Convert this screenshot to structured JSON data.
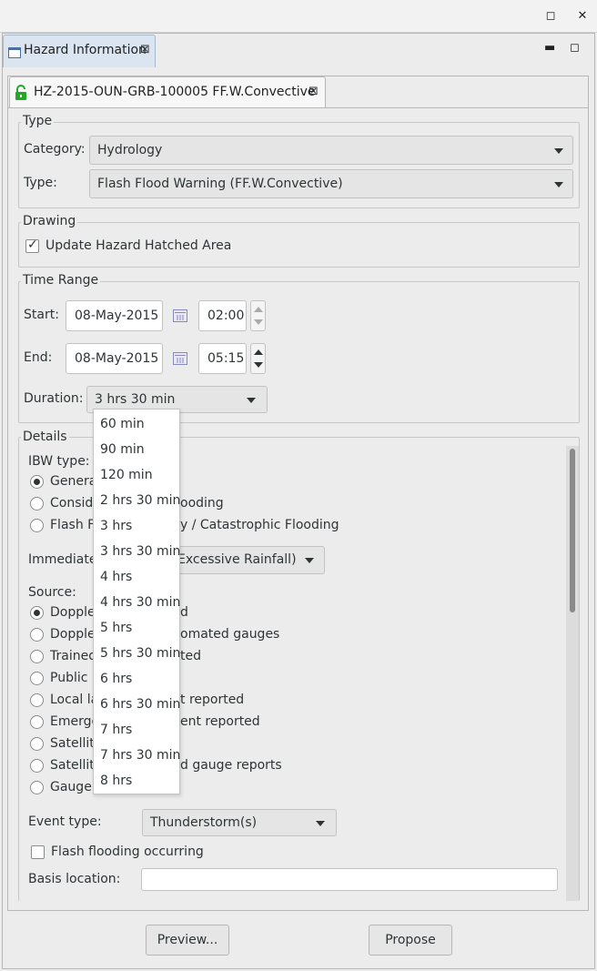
{
  "window": {
    "maximize_glyph": "◻",
    "close_glyph": "✕"
  },
  "view_tab": {
    "label": "Hazard Information",
    "close_glyph": "⊠",
    "minimize_glyph": "▬",
    "maximize_glyph": "◻"
  },
  "hazard_tab": {
    "label": "HZ-2015-OUN-GRB-100005 FF.W.Convective",
    "close_glyph": "⊠",
    "lock_color": "#23a823"
  },
  "type_group": {
    "legend": "Type",
    "category_label": "Category:",
    "category_value": "Hydrology",
    "type_label": "Type:",
    "type_value": "Flash Flood Warning (FF.W.Convective)"
  },
  "drawing_group": {
    "legend": "Drawing",
    "update_hatched_label": "Update Hazard Hatched Area",
    "update_hatched_checked": true
  },
  "time_group": {
    "legend": "Time Range",
    "start_label": "Start:",
    "start_date": "08-May-2015",
    "start_time": "02:00",
    "end_label": "End:",
    "end_date": "08-May-2015",
    "end_time": "05:15",
    "duration_label": "Duration:",
    "duration_value": "3 hrs 30 min"
  },
  "details_group": {
    "legend": "Details",
    "ibw_label": "IBW type:",
    "ibw_options": [
      {
        "visible_left": "Genera",
        "visible_right": "",
        "selected": true
      },
      {
        "visible_left": "Conside",
        "visible_right": "ooding",
        "selected": false
      },
      {
        "visible_left": "Flash F",
        "visible_right": "y / Catastrophic Flooding",
        "selected": false
      }
    ],
    "immediate_label": "Immediate",
    "immediate_value_visible": "Excessive Rainfall)",
    "source_label": "Source:",
    "sources": [
      {
        "visible_left": "Dopple",
        "visible_right": "d",
        "selected": true
      },
      {
        "visible_left": "Dopple",
        "visible_right": "omated gauges",
        "selected": false
      },
      {
        "visible_left": "Trained",
        "visible_right": "ted",
        "selected": false
      },
      {
        "visible_left": "Public r",
        "visible_right": "",
        "selected": false
      },
      {
        "visible_left": "Local la",
        "visible_right": "t reported",
        "selected": false
      },
      {
        "visible_left": "Emerge",
        "visible_right": "ent reported",
        "selected": false
      },
      {
        "visible_left": "Satellit",
        "visible_right": "",
        "selected": false
      },
      {
        "visible_left": "Satellit",
        "visible_right": "d gauge reports",
        "selected": false
      },
      {
        "visible_left": "Gauge r",
        "visible_right": "",
        "selected": false
      }
    ],
    "event_type_label": "Event type:",
    "event_type_value": "Thunderstorm(s)",
    "flash_flooding_label": "Flash flooding occurring",
    "flash_flooding_checked": false,
    "basis_location_label": "Basis location:",
    "basis_location_value": ""
  },
  "duration_popup": {
    "options": [
      "60 min",
      "90 min",
      "120 min",
      "2 hrs 30 min",
      "3 hrs",
      "3 hrs 30 min",
      "4 hrs",
      "4 hrs 30 min",
      "5 hrs",
      "5 hrs 30 min",
      "6 hrs",
      "6 hrs 30 min",
      "7 hrs",
      "7 hrs 30 min",
      "8 hrs"
    ]
  },
  "footer": {
    "preview_label": "Preview...",
    "propose_label": "Propose"
  }
}
